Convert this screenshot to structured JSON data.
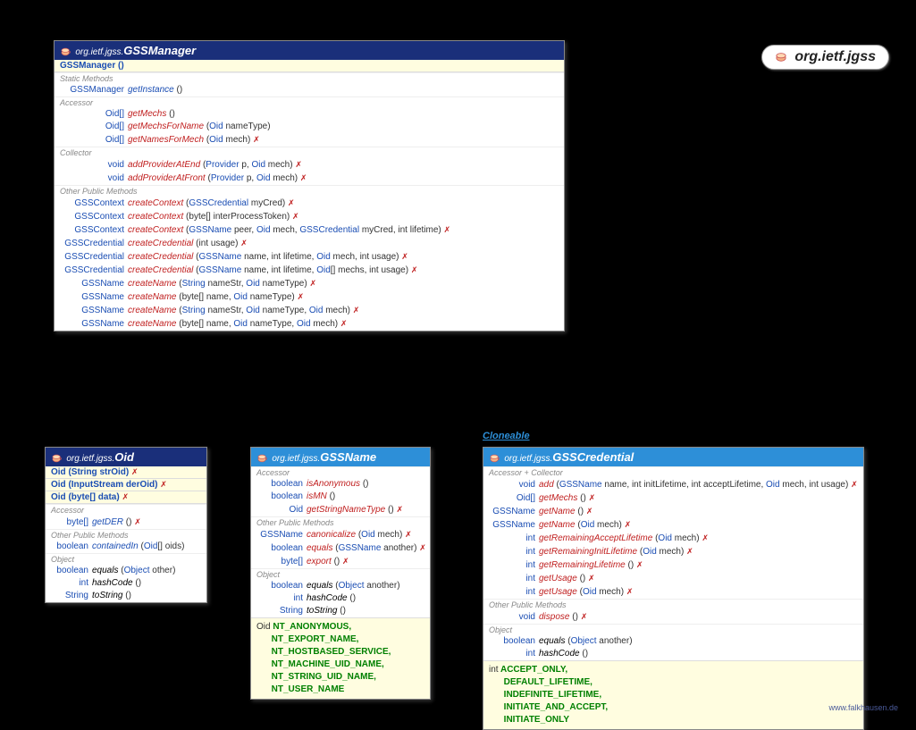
{
  "package_title": "org.ietf.jgss",
  "footer": "www.falkhausen.de",
  "cloneable": "Cloneable",
  "gssmanager": {
    "pkg": "org.ietf.jgss.",
    "name": "GSSManager",
    "ctors": [
      {
        "sig": "GSSManager ()"
      }
    ],
    "sections": [
      {
        "label": "Static Methods",
        "rows": [
          {
            "ret": "GSSManager",
            "name": "getInstance",
            "params": "()",
            "style": "link"
          }
        ]
      },
      {
        "label": "Accessor",
        "rows": [
          {
            "ret": "Oid[]",
            "name": "getMechs",
            "params": "()",
            "style": "abs"
          },
          {
            "ret": "Oid[]",
            "name": "getMechsForName",
            "params": "(Oid nameType)",
            "style": "abs"
          },
          {
            "ret": "Oid[]",
            "name": "getNamesForMech",
            "params": "(Oid mech)",
            "style": "abs",
            "throws": true
          }
        ]
      },
      {
        "label": "Collector",
        "rows": [
          {
            "ret": "void",
            "name": "addProviderAtEnd",
            "params": "(Provider p, Oid mech)",
            "style": "abs",
            "throws": true
          },
          {
            "ret": "void",
            "name": "addProviderAtFront",
            "params": "(Provider p, Oid mech)",
            "style": "abs",
            "throws": true
          }
        ]
      },
      {
        "label": "Other Public Methods",
        "rows": [
          {
            "ret": "GSSContext",
            "name": "createContext",
            "params": "(GSSCredential myCred)",
            "style": "abs",
            "throws": true
          },
          {
            "ret": "GSSContext",
            "name": "createContext",
            "params": "(byte[] interProcessToken)",
            "style": "abs",
            "throws": true
          },
          {
            "ret": "GSSContext",
            "name": "createContext",
            "params": "(GSSName peer, Oid mech, GSSCredential myCred, int lifetime)",
            "style": "abs",
            "throws": true
          },
          {
            "ret": "GSSCredential",
            "name": "createCredential",
            "params": "(int usage)",
            "style": "abs",
            "throws": true
          },
          {
            "ret": "GSSCredential",
            "name": "createCredential",
            "params": "(GSSName name, int lifetime, Oid mech, int usage)",
            "style": "abs",
            "throws": true
          },
          {
            "ret": "GSSCredential",
            "name": "createCredential",
            "params": "(GSSName name, int lifetime, Oid[] mechs, int usage)",
            "style": "abs",
            "throws": true
          },
          {
            "ret": "GSSName",
            "name": "createName",
            "params": "(String nameStr, Oid nameType)",
            "style": "abs",
            "throws": true
          },
          {
            "ret": "GSSName",
            "name": "createName",
            "params": "(byte[] name, Oid nameType)",
            "style": "abs",
            "throws": true
          },
          {
            "ret": "GSSName",
            "name": "createName",
            "params": "(String nameStr, Oid nameType, Oid mech)",
            "style": "abs",
            "throws": true
          },
          {
            "ret": "GSSName",
            "name": "createName",
            "params": "(byte[] name, Oid nameType, Oid mech)",
            "style": "abs",
            "throws": true
          }
        ]
      }
    ]
  },
  "oid": {
    "pkg": "org.ietf.jgss.",
    "name": "Oid",
    "ctors": [
      {
        "sig": "Oid (String strOid)",
        "throws": true
      },
      {
        "sig": "Oid (InputStream derOid)",
        "throws": true
      },
      {
        "sig": "Oid (byte[] data)",
        "throws": true
      }
    ],
    "sections": [
      {
        "label": "Accessor",
        "rows": [
          {
            "ret": "byte[]",
            "name": "getDER",
            "params": "()",
            "style": "link",
            "throws": true
          }
        ]
      },
      {
        "label": "Other Public Methods",
        "rows": [
          {
            "ret": "boolean",
            "name": "containedIn",
            "params": "(Oid[] oids)",
            "style": "link"
          }
        ]
      },
      {
        "label": "Object",
        "rows": [
          {
            "ret": "boolean",
            "name": "equals",
            "params": "(Object other)",
            "style": "plain"
          },
          {
            "ret": "int",
            "name": "hashCode",
            "params": "()",
            "style": "plain"
          },
          {
            "ret": "String",
            "name": "toString",
            "params": "()",
            "style": "plain"
          }
        ]
      }
    ]
  },
  "gssname": {
    "pkg": "org.ietf.jgss.",
    "name": "GSSName",
    "sections": [
      {
        "label": "Accessor",
        "rows": [
          {
            "ret": "boolean",
            "name": "isAnonymous",
            "params": "()",
            "style": "abs"
          },
          {
            "ret": "boolean",
            "name": "isMN",
            "params": "()",
            "style": "abs"
          },
          {
            "ret": "Oid",
            "name": "getStringNameType",
            "params": "()",
            "style": "abs",
            "throws": true
          }
        ]
      },
      {
        "label": "Other Public Methods",
        "rows": [
          {
            "ret": "GSSName",
            "name": "canonicalize",
            "params": "(Oid mech)",
            "style": "abs",
            "throws": true
          },
          {
            "ret": "boolean",
            "name": "equals",
            "params": "(GSSName another)",
            "style": "abs",
            "throws": true
          },
          {
            "ret": "byte[]",
            "name": "export",
            "params": "()",
            "style": "abs",
            "throws": true
          }
        ]
      },
      {
        "label": "Object",
        "rows": [
          {
            "ret": "boolean",
            "name": "equals",
            "params": "(Object another)",
            "style": "plain"
          },
          {
            "ret": "int",
            "name": "hashCode",
            "params": "()",
            "style": "plain"
          },
          {
            "ret": "String",
            "name": "toString",
            "params": "()",
            "style": "plain"
          }
        ]
      }
    ],
    "constants": {
      "type": "Oid",
      "values": "NT_ANONYMOUS, NT_EXPORT_NAME, NT_HOSTBASED_SERVICE, NT_MACHINE_UID_NAME, NT_STRING_UID_NAME, NT_USER_NAME"
    }
  },
  "gsscred": {
    "pkg": "org.ietf.jgss.",
    "name": "GSSCredential",
    "sections": [
      {
        "label": "Accessor + Collector",
        "rows": [
          {
            "ret": "void",
            "name": "add",
            "params": "(GSSName name, int initLifetime, int acceptLifetime, Oid mech, int usage)",
            "style": "abs",
            "throws": true
          },
          {
            "ret": "Oid[]",
            "name": "getMechs",
            "params": "()",
            "style": "abs",
            "throws": true
          },
          {
            "ret": "GSSName",
            "name": "getName",
            "params": "()",
            "style": "abs",
            "throws": true
          },
          {
            "ret": "GSSName",
            "name": "getName",
            "params": "(Oid mech)",
            "style": "abs",
            "throws": true
          },
          {
            "ret": "int",
            "name": "getRemainingAcceptLifetime",
            "params": "(Oid mech)",
            "style": "abs",
            "throws": true
          },
          {
            "ret": "int",
            "name": "getRemainingInitLifetime",
            "params": "(Oid mech)",
            "style": "abs",
            "throws": true
          },
          {
            "ret": "int",
            "name": "getRemainingLifetime",
            "params": "()",
            "style": "abs",
            "throws": true
          },
          {
            "ret": "int",
            "name": "getUsage",
            "params": "()",
            "style": "abs",
            "throws": true
          },
          {
            "ret": "int",
            "name": "getUsage",
            "params": "(Oid mech)",
            "style": "abs",
            "throws": true
          }
        ]
      },
      {
        "label": "Other Public Methods",
        "rows": [
          {
            "ret": "void",
            "name": "dispose",
            "params": "()",
            "style": "abs",
            "throws": true
          }
        ]
      },
      {
        "label": "Object",
        "rows": [
          {
            "ret": "boolean",
            "name": "equals",
            "params": "(Object another)",
            "style": "plain"
          },
          {
            "ret": "int",
            "name": "hashCode",
            "params": "()",
            "style": "plain"
          }
        ]
      }
    ],
    "constants": {
      "type": "int",
      "values": "ACCEPT_ONLY, DEFAULT_LIFETIME, INDEFINITE_LIFETIME, INITIATE_AND_ACCEPT, INITIATE_ONLY"
    }
  }
}
